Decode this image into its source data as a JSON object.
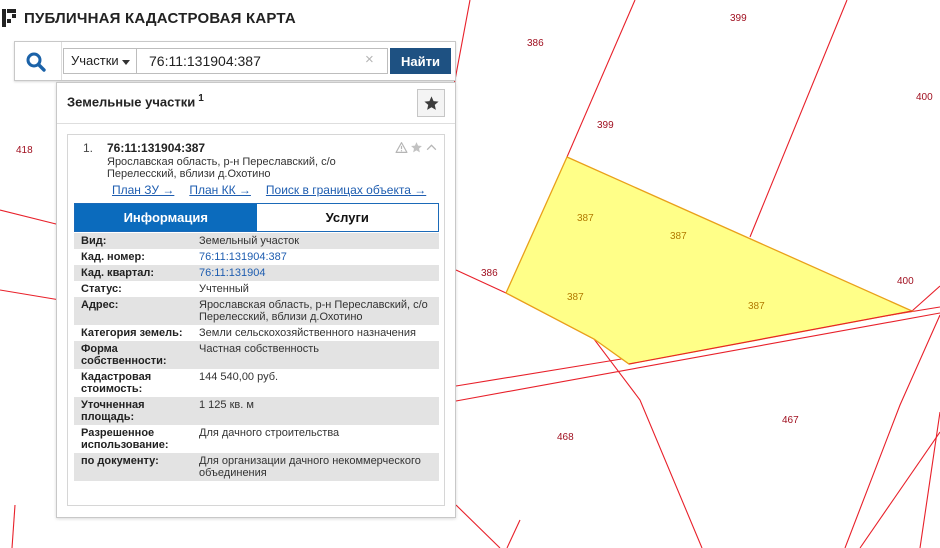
{
  "header": {
    "title": "ПУБЛИЧНАЯ КАДАСТРОВАЯ КАРТА"
  },
  "search": {
    "type_label": "Участки",
    "query": "76:11:131904:387",
    "clear_glyph": "×",
    "find_label": "Найти"
  },
  "panel": {
    "title": "Земельные участки",
    "count": "1",
    "item": {
      "index": "1.",
      "cadastral_number": "76:11:131904:387",
      "address": "Ярославская область, р-н Переславский, с/о Перелесский, вблизи д.Охотино",
      "links": [
        "План ЗУ →",
        "План КК →",
        "Поиск в границах объекта →"
      ],
      "tabs": {
        "info": "Информация",
        "services": "Услуги"
      },
      "rows": [
        {
          "label": "Вид:",
          "value": "Земельный участок"
        },
        {
          "label": "Кад. номер:",
          "value": "76:11:131904:387"
        },
        {
          "label": "Кад. квартал:",
          "value": "76:11:131904"
        },
        {
          "label": "Статус:",
          "value": "Учтенный"
        },
        {
          "label": "Адрес:",
          "value": "Ярославская область, р-н Переславский, с/о Перелесский, вблизи д.Охотино"
        },
        {
          "label": "Категория земель:",
          "value": "Земли сельскохозяйственного назначения"
        },
        {
          "label": "Форма собственности:",
          "value": "Частная собственность"
        },
        {
          "label": "Кадастровая стоимость:",
          "value": "144 540,00 руб."
        },
        {
          "label": "Уточненная площадь:",
          "value": "1 125 кв. м"
        },
        {
          "label": "Разрешенное использование:",
          "value": "Для дачного строительства"
        },
        {
          "label": "по документу:",
          "value": "Для организации дачного некоммерческого объединения"
        }
      ]
    }
  },
  "map": {
    "labels": {
      "l399a": "399",
      "l386a": "386",
      "l400a": "400",
      "l418": "418",
      "l399b": "399",
      "l387a": "387",
      "l387b": "387",
      "l387c": "387",
      "l387d": "387",
      "l386b": "386",
      "l400b": "400",
      "l467": "467",
      "l468": "468"
    }
  },
  "colors": {
    "parcel_fill": "#ffff88",
    "boundary": "#e8202a",
    "accent_button": "#1e5182",
    "tab_active": "#0b6bbd",
    "link": "#1e5db0"
  },
  "icons": {
    "logo": "pkk-logo-icon",
    "search": "search-icon",
    "favorite": "star-icon",
    "warning": "warning-icon",
    "collapse": "chevron-up-icon"
  }
}
